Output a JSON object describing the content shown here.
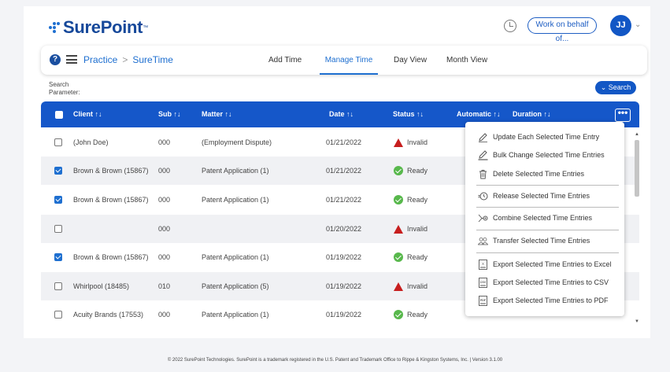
{
  "app": {
    "logo_text": "SurePoint",
    "logo_tm": "™"
  },
  "header": {
    "work_on_behalf": "Work on behalf of...",
    "avatar_initials": "JJ"
  },
  "nav": {
    "help": "?",
    "breadcrumb": [
      "Practice",
      ">",
      "SureTime"
    ],
    "tabs": [
      {
        "label": "Add Time",
        "active": false
      },
      {
        "label": "Manage Time",
        "active": true
      },
      {
        "label": "Day View",
        "active": false
      },
      {
        "label": "Month View",
        "active": false
      }
    ]
  },
  "search": {
    "param_label": "Search Parameter:",
    "button": "Search",
    "chevron": "⌄"
  },
  "table": {
    "columns": [
      "Client ↑↓",
      "Sub ↑↓",
      "Matter ↑↓",
      "Date ↑↓",
      "Status ↑↓",
      "Automatic ↑↓",
      "Duration ↑↓"
    ],
    "more": "•••",
    "rows": [
      {
        "checked": false,
        "client": "(John Doe)",
        "sub": "000",
        "matter": "(Employment Dispute)",
        "date": "01/21/2022",
        "status": "Invalid"
      },
      {
        "checked": true,
        "client": "Brown & Brown (15867)",
        "sub": "000",
        "matter": "Patent Application (1)",
        "date": "01/21/2022",
        "status": "Ready"
      },
      {
        "checked": true,
        "client": "Brown & Brown (15867)",
        "sub": "000",
        "matter": "Patent Application (1)",
        "date": "01/21/2022",
        "status": "Ready"
      },
      {
        "checked": false,
        "client": "",
        "sub": "000",
        "matter": "",
        "date": "01/20/2022",
        "status": "Invalid"
      },
      {
        "checked": true,
        "client": "Brown & Brown (15867)",
        "sub": "000",
        "matter": "Patent Application (1)",
        "date": "01/19/2022",
        "status": "Ready"
      },
      {
        "checked": false,
        "client": "Whirlpool (18485)",
        "sub": "010",
        "matter": "Patent Application (5)",
        "date": "01/19/2022",
        "status": "Invalid"
      },
      {
        "checked": false,
        "client": "Acuity Brands (17553)",
        "sub": "000",
        "matter": "Patent Application (1)",
        "date": "01/19/2022",
        "status": "Ready"
      }
    ]
  },
  "menu": {
    "items": [
      {
        "label": "Update Each Selected Time Entry",
        "icon": "pencil-icon"
      },
      {
        "label": "Bulk Change Selected Time Entries",
        "icon": "pencil-line-icon"
      },
      {
        "label": "Delete Selected Time Entries",
        "icon": "trash-icon"
      },
      {
        "label": "Release Selected Time Entries",
        "icon": "release-clock-icon"
      },
      {
        "label": "Combine Selected Time Entries",
        "icon": "combine-icon"
      },
      {
        "label": "Transfer Selected Time Entries",
        "icon": "users-icon"
      },
      {
        "label": "Export Selected Time Entries to Excel",
        "icon": "excel-file-icon"
      },
      {
        "label": "Export Selected Time Entries to CSV",
        "icon": "csv-file-icon"
      },
      {
        "label": "Export Selected Time Entries to PDF",
        "icon": "pdf-file-icon"
      }
    ],
    "file_tags": {
      "excel": "X",
      "csv": "CSV",
      "pdf": "PDF"
    }
  },
  "footer": {
    "text": "© 2022 SurePoint Technologies. SurePoint is a trademark registered in the U.S. Patent and Trademark Office to Rippe & Kingston Systems, Inc. | Version 3.1.00"
  },
  "colors": {
    "brand": "#1557c9",
    "invalid": "#c71e1e",
    "ready": "#58b84c"
  }
}
